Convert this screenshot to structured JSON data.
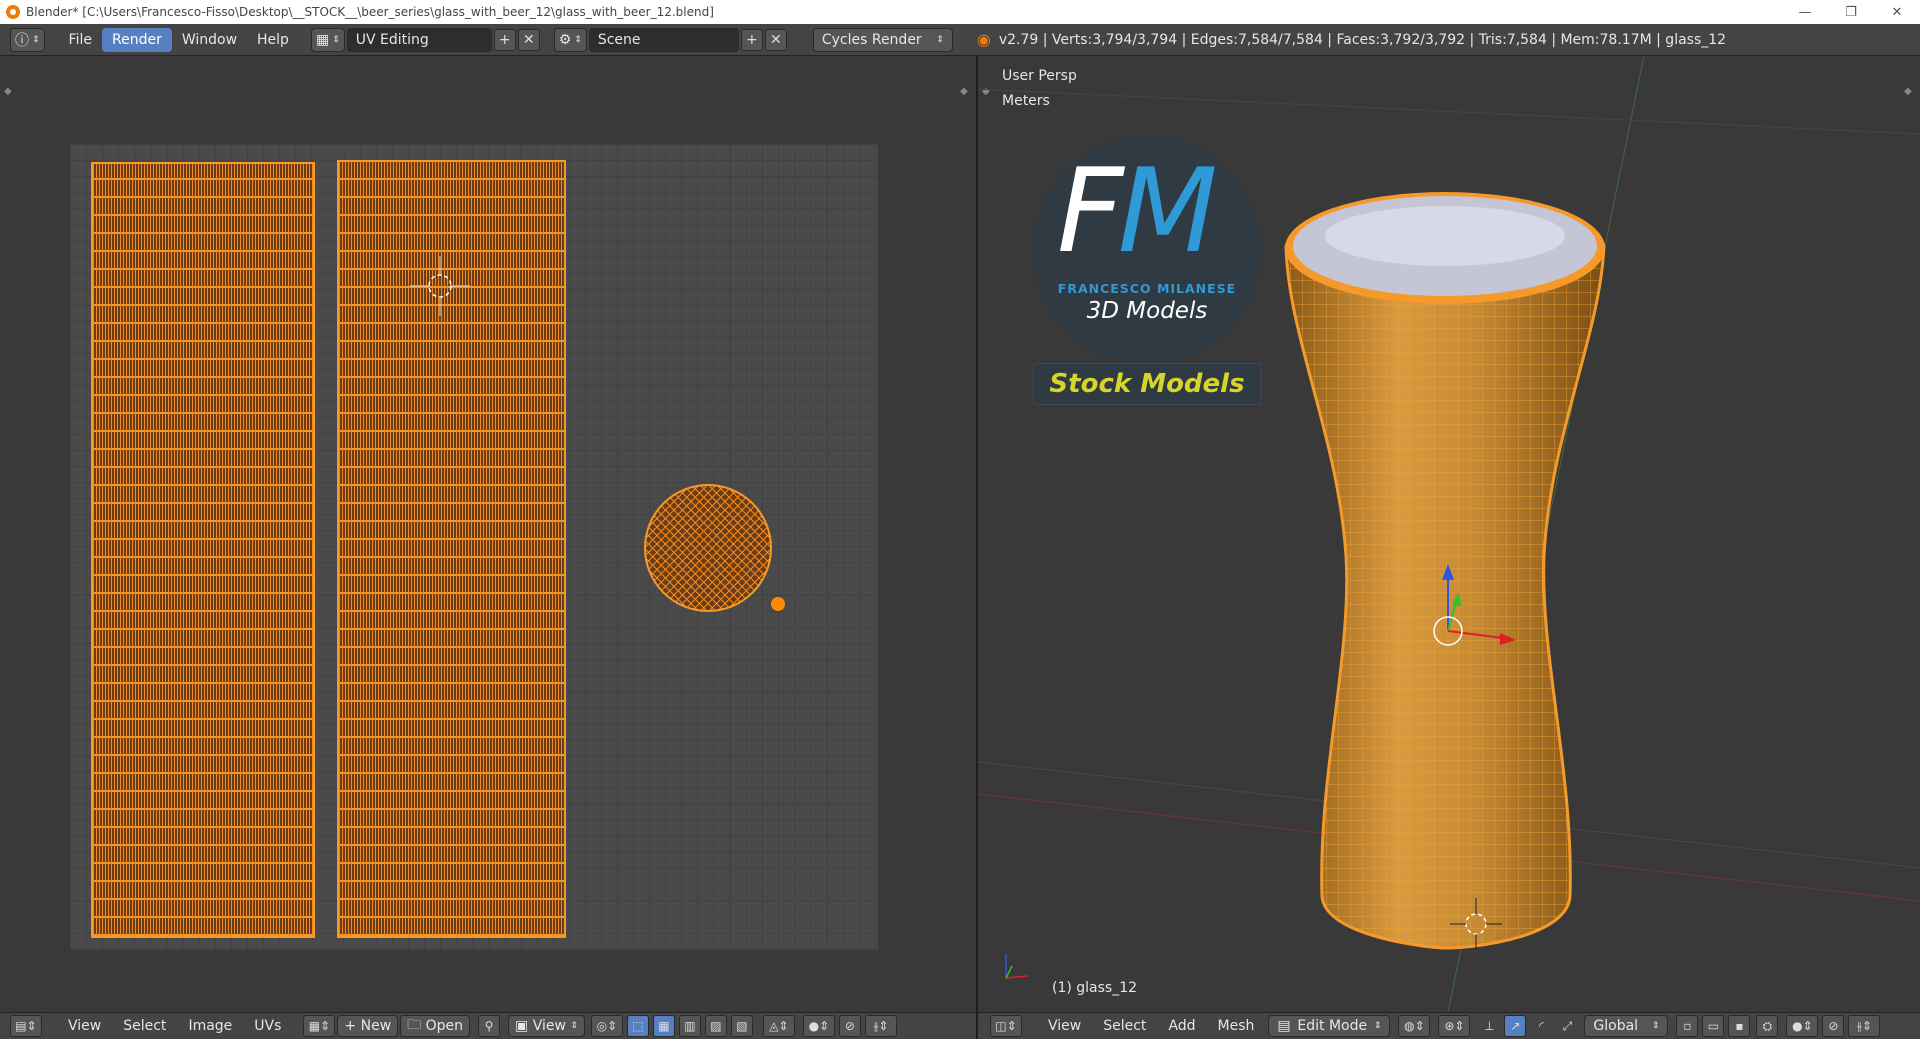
{
  "window": {
    "title": "Blender* [C:\\Users\\Francesco-Fisso\\Desktop\\__STOCK__\\beer_series\\glass_with_beer_12\\glass_with_beer_12.blend]",
    "minimize": "—",
    "restore": "❐",
    "close": "✕"
  },
  "topbar": {
    "menus": [
      "File",
      "Render",
      "Window",
      "Help"
    ],
    "layout": "UV Editing",
    "scene": "Scene",
    "engine": "Cycles Render",
    "stats": "v2.79 | Verts:3,794/3,794 | Edges:7,584/7,584 | Faces:3,792/3,792 | Tris:7,584 | Mem:78.17M | glass_12"
  },
  "viewport": {
    "persp": "User Persp",
    "units": "Meters",
    "object_label": "(1) glass_12"
  },
  "logo": {
    "f": "F",
    "m": "M",
    "line1": "FRANCESCO MILANESE",
    "line2": "3D Models",
    "badge": "Stock Models"
  },
  "uv_header": {
    "menus": [
      "View",
      "Select",
      "Image",
      "UVs"
    ],
    "new": "New",
    "open": "Open",
    "view": "View"
  },
  "view3d_header": {
    "menus": [
      "View",
      "Select",
      "Add",
      "Mesh"
    ],
    "mode": "Edit Mode",
    "orientation": "Global"
  },
  "colors": {
    "selection": "#f59a2a",
    "active": "#5680c2",
    "background": "#393939"
  }
}
